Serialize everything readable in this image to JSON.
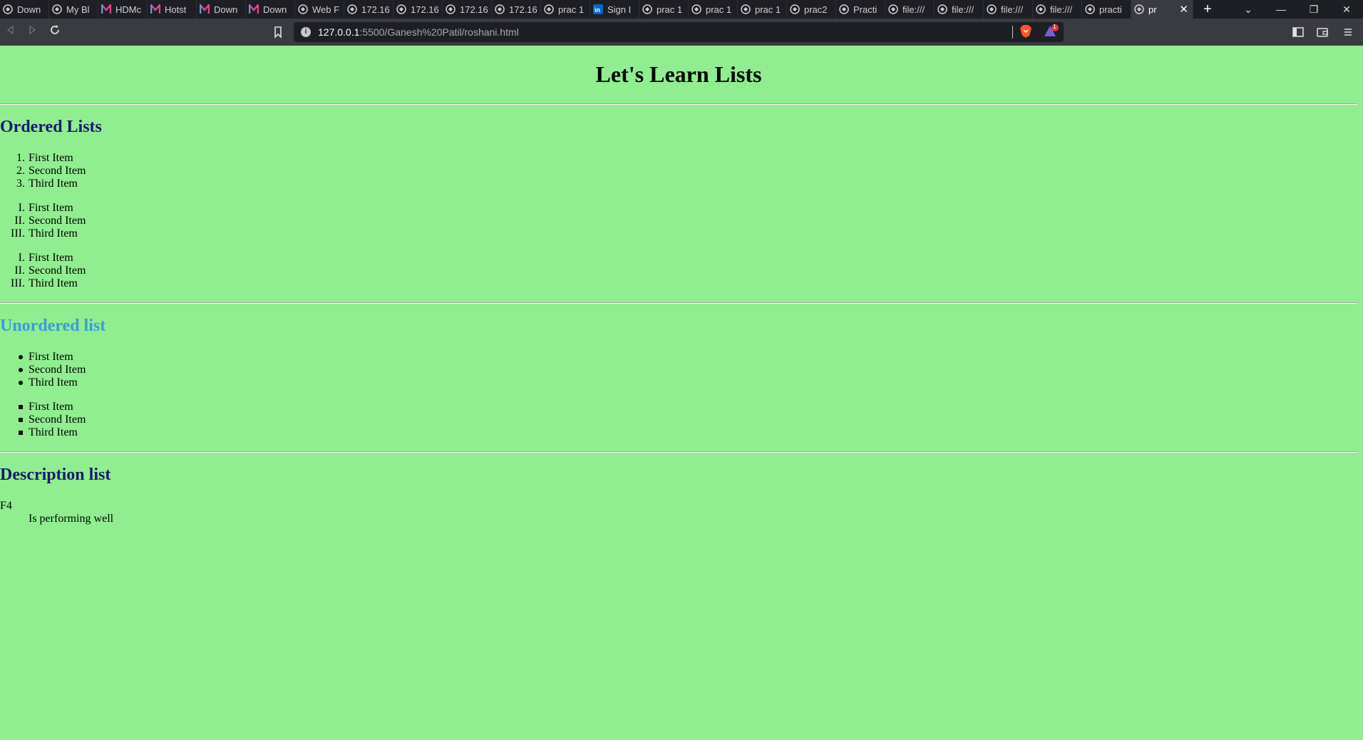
{
  "browser": {
    "tabs": [
      {
        "title": "Down",
        "icon": "globe-icon"
      },
      {
        "title": "My Bl",
        "icon": "globe-icon"
      },
      {
        "title": "HDMc",
        "icon": "m-logo-icon"
      },
      {
        "title": "Hotst",
        "icon": "m-logo-icon"
      },
      {
        "title": "Down",
        "icon": "m-logo-icon"
      },
      {
        "title": "Down",
        "icon": "m-logo-icon"
      },
      {
        "title": "Web F",
        "icon": "globe-icon"
      },
      {
        "title": "172.16",
        "icon": "globe-icon"
      },
      {
        "title": "172.16",
        "icon": "globe-icon"
      },
      {
        "title": "172.16",
        "icon": "globe-icon"
      },
      {
        "title": "172.16",
        "icon": "globe-icon"
      },
      {
        "title": "prac 1",
        "icon": "globe-icon"
      },
      {
        "title": "Sign I",
        "icon": "linkedin-icon"
      },
      {
        "title": "prac 1",
        "icon": "globe-icon"
      },
      {
        "title": "prac 1",
        "icon": "globe-icon"
      },
      {
        "title": "prac 1",
        "icon": "globe-icon"
      },
      {
        "title": "prac2",
        "icon": "globe-icon"
      },
      {
        "title": "Practi",
        "icon": "globe-icon"
      },
      {
        "title": "file:///",
        "icon": "globe-icon"
      },
      {
        "title": "file:///",
        "icon": "globe-icon"
      },
      {
        "title": "file:///",
        "icon": "globe-icon"
      },
      {
        "title": "file:///",
        "icon": "globe-icon"
      },
      {
        "title": "practi",
        "icon": "globe-icon"
      }
    ],
    "active_tab": {
      "title": "pr",
      "close": "✕"
    },
    "new_tab": "+",
    "window_controls": {
      "tab_search": "⌄",
      "minimize": "—",
      "restore": "❐",
      "close": "✕"
    },
    "address": {
      "host": "127.0.0.1",
      "path": ":5500/Ganesh%20Patil/roshani.html"
    },
    "rewards_badge": "1"
  },
  "page": {
    "title": "Let's Learn Lists",
    "ordered": {
      "heading": "Ordered Lists",
      "heading_color": "#191970",
      "lists": [
        {
          "markers": [
            "1.",
            "2.",
            "3."
          ],
          "items": [
            "First Item",
            "Second Item",
            "Third Item"
          ]
        },
        {
          "markers": [
            "I.",
            "II.",
            "III."
          ],
          "items": [
            "First Item",
            "Second Item",
            "Third Item"
          ]
        },
        {
          "markers": [
            "I.",
            "II.",
            "III."
          ],
          "items": [
            "First Item",
            "Second Item",
            "Third Item"
          ]
        }
      ]
    },
    "unordered": {
      "heading": "Unordered list",
      "heading_color": "#3B9BD8",
      "lists": [
        {
          "bullet": "disc",
          "items": [
            "First Item",
            "Second Item",
            "Third Item"
          ]
        },
        {
          "bullet": "square",
          "items": [
            "First Item",
            "Second Item",
            "Third Item"
          ]
        }
      ]
    },
    "description": {
      "heading": "Description list",
      "heading_color": "#191970",
      "term": "F4",
      "definition": "Is performing well"
    }
  }
}
